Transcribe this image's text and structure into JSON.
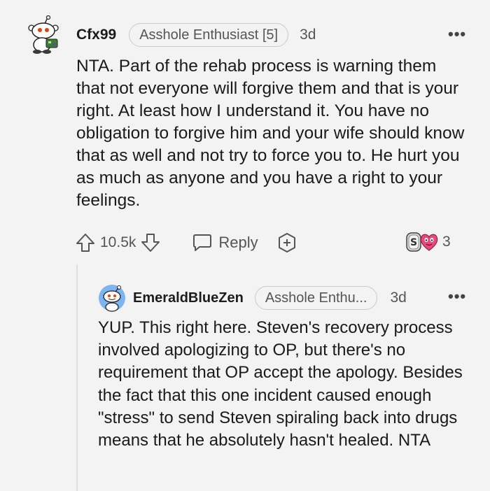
{
  "comment": {
    "username": "Cfx99",
    "flair": "Asshole Enthusiast [5]",
    "age": "3d",
    "more": "•••",
    "body": "NTA. Part of the rehab process is warning them that not everyone will forgive them and that is your right. At least how I understand it. You have no obligation to forgive him and your wife should know that as well and not try to force you to. He hurt you as much as anyone and you have a right to your feelings.",
    "votes": "10.5k",
    "reply_label": "Reply",
    "award_count": "3",
    "avatar_icon": "snoo-avatar-icon",
    "award_icons": [
      "silver-award-icon",
      "wholesome-heart-award-icon"
    ]
  },
  "reply": {
    "username": "EmeraldBlueZen",
    "flair": "Asshole Enthu...",
    "age": "3d",
    "more": "•••",
    "body": "YUP. This right here. Steven's recovery process involved apologizing to OP, but there's no requirement that OP accept the apology. Besides the fact that this one incident caused enough \"stress\" to send Steven spiraling back into drugs means that he absolutely hasn't healed. NTA",
    "avatar_icon": "snoo-avatar-icon"
  },
  "colors": {
    "background": "#f3f3f3",
    "text": "#1a1a1b",
    "meta": "#555555",
    "flair_border": "#c9c9c9",
    "award_heart": "#e8497a"
  }
}
